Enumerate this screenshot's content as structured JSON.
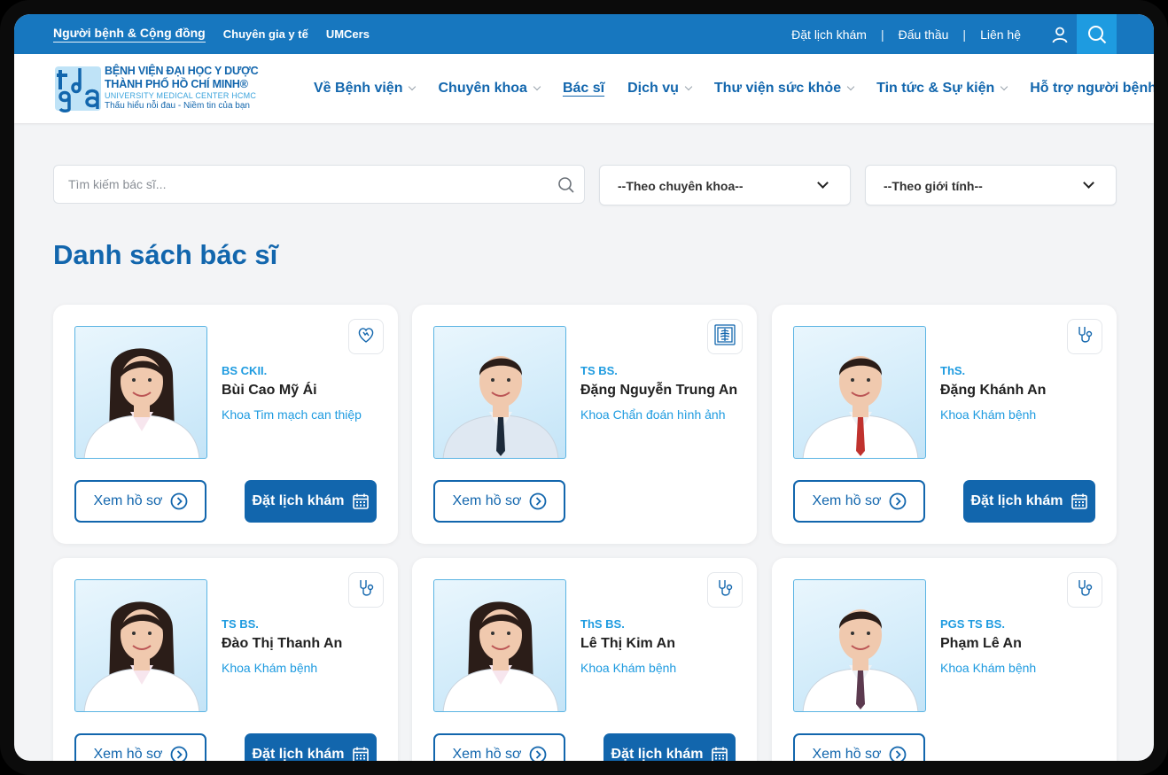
{
  "topbar": {
    "tabs": [
      "Người bệnh & Cộng đồng",
      "Chuyên gia y tế",
      "UMCers"
    ],
    "links": [
      "Đặt lịch khám",
      "Đấu thầu",
      "Liên hệ"
    ],
    "separator": "|"
  },
  "logo": {
    "line1": "BỆNH VIỆN ĐẠI HỌC Y DƯỢC",
    "line2": "THÀNH PHỐ HỒ CHÍ MINH®",
    "line3": "UNIVERSITY MEDICAL CENTER HCMC",
    "line4": "Thấu hiểu nỗi đau - Niềm tin của bạn"
  },
  "nav": [
    {
      "label": "Về Bệnh viện",
      "dropdown": true
    },
    {
      "label": "Chuyên khoa",
      "dropdown": true
    },
    {
      "label": "Bác sĩ",
      "dropdown": false,
      "active": true
    },
    {
      "label": "Dịch vụ",
      "dropdown": true
    },
    {
      "label": "Thư viện sức khỏe",
      "dropdown": true
    },
    {
      "label": "Tin tức & Sự kiện",
      "dropdown": true
    },
    {
      "label": "Hỗ trợ người bệnh",
      "dropdown": true
    }
  ],
  "filters": {
    "search_placeholder": "Tìm kiếm bác sĩ...",
    "specialty": "--Theo chuyên khoa--",
    "gender": "--Theo giới tính--"
  },
  "page_title": "Danh sách bác sĩ",
  "buttons": {
    "view": "Xem hồ sơ",
    "book": "Đặt lịch khám"
  },
  "doctors": [
    {
      "degree": "BS CKII.",
      "name": "Bùi Cao Mỹ Ái",
      "dept": "Khoa Tim mạch can thiệp",
      "icon": "heart-icon",
      "bookable": true,
      "gender": "f",
      "suit": "#ffffff",
      "tie": ""
    },
    {
      "degree": "TS BS.",
      "name": "Đặng Nguyễn Trung An",
      "dept": "Khoa Chẩn đoán hình ảnh",
      "icon": "xray-icon",
      "bookable": false,
      "gender": "m",
      "suit": "#dfe8f2",
      "tie": "#1d2a3a"
    },
    {
      "degree": "ThS.",
      "name": "Đặng Khánh An",
      "dept": "Khoa Khám bệnh",
      "icon": "stethoscope-icon",
      "bookable": true,
      "gender": "m",
      "suit": "#ffffff",
      "tie": "#c0322e"
    },
    {
      "degree": "TS BS.",
      "name": "Đào Thị Thanh An",
      "dept": "Khoa Khám bệnh",
      "icon": "stethoscope-icon",
      "bookable": true,
      "gender": "f",
      "suit": "#ffffff",
      "tie": ""
    },
    {
      "degree": "ThS BS.",
      "name": "Lê Thị Kim An",
      "dept": "Khoa Khám bệnh",
      "icon": "stethoscope-icon",
      "bookable": true,
      "gender": "f",
      "suit": "#ffffff",
      "tie": ""
    },
    {
      "degree": "PGS TS BS.",
      "name": "Phạm Lê An",
      "dept": "Khoa Khám bệnh",
      "icon": "stethoscope-icon",
      "bookable": false,
      "gender": "m",
      "suit": "#ffffff",
      "tie": "#5c3a4f"
    }
  ],
  "colors": {
    "brand": "#1266ad",
    "topbar": "#1777bf",
    "accent": "#1e9be0",
    "background": "#f3f4f6"
  }
}
